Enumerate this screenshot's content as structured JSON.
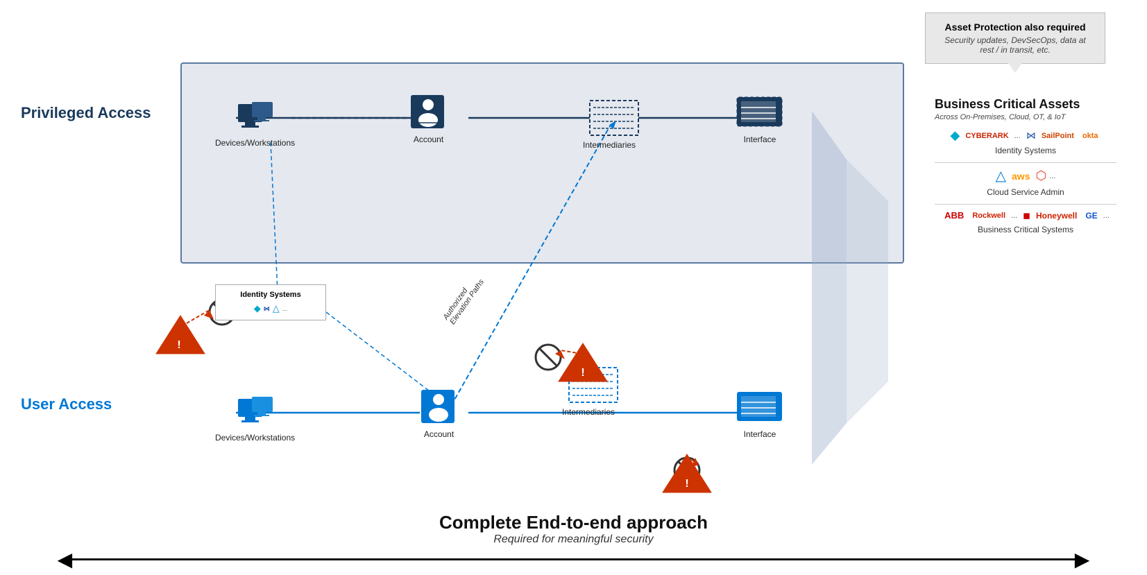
{
  "callout": {
    "title": "Asset Protection also required",
    "subtitle": "Security updates, DevSecOps, data at rest / in transit, etc."
  },
  "labels": {
    "privileged": "Privileged Access",
    "user": "User Access"
  },
  "nodes": {
    "priv_devices": "Devices/Workstations",
    "priv_account": "Account",
    "priv_intermediaries": "Intermediaries",
    "priv_interface": "Interface",
    "user_devices": "Devices/Workstations",
    "user_account": "Account",
    "user_intermediaries": "Intermediaries",
    "user_interface": "Interface",
    "identity_systems": "Identity Systems"
  },
  "bca": {
    "title": "Business Critical Assets",
    "subtitle": "Across On-Premises, Cloud, OT, & IoT",
    "sections": [
      {
        "label": "Identity Systems",
        "logos": [
          "Ping",
          "CYBERARK",
          "SailPoint",
          "okta",
          "..."
        ]
      },
      {
        "label": "Cloud Service Admin",
        "logos": [
          "Azure",
          "aws",
          "GCP",
          "..."
        ]
      },
      {
        "label": "Business Critical Systems",
        "logos": [
          "ABB",
          "Rockwell",
          "Honeywell",
          "GE",
          "..."
        ]
      }
    ]
  },
  "elevation_label": "Authorized\nElevation Paths",
  "bottom": {
    "title": "Complete End-to-end approach",
    "subtitle": "Required for meaningful security"
  }
}
